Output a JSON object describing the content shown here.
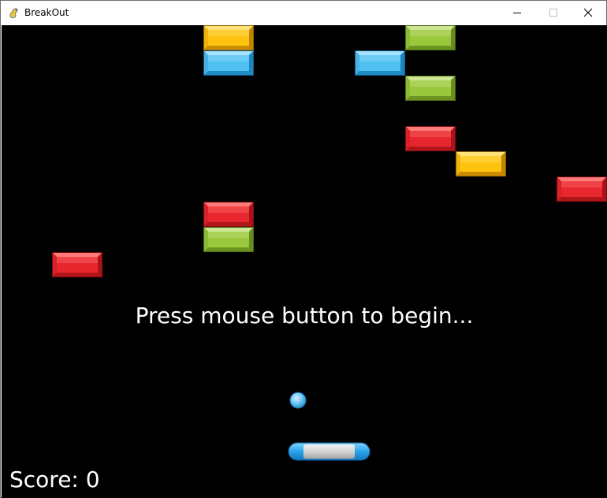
{
  "window": {
    "title": "BreakOut",
    "icon": "pygame-snake-icon",
    "controls": [
      "minimize-icon",
      "maximize-icon",
      "close-icon"
    ]
  },
  "game": {
    "message": "Press mouse button to begin...",
    "score_label": "Score: 0",
    "score": 0,
    "colors": {
      "background": "#000000",
      "text": "#ffffff",
      "yellow": "#ffc20e",
      "blue": "#4fc1f0",
      "green": "#9ac83c",
      "red": "#e8262d"
    },
    "bricks": [
      {
        "color": "yellow",
        "col": 4,
        "row": 0
      },
      {
        "color": "green",
        "col": 8,
        "row": 0
      },
      {
        "color": "blue",
        "col": 4,
        "row": 1
      },
      {
        "color": "blue",
        "col": 7,
        "row": 1
      },
      {
        "color": "green",
        "col": 8,
        "row": 2
      },
      {
        "color": "red",
        "col": 8,
        "row": 4
      },
      {
        "color": "yellow",
        "col": 9,
        "row": 5
      },
      {
        "color": "red",
        "col": 11,
        "row": 6
      },
      {
        "color": "red",
        "col": 4,
        "row": 7
      },
      {
        "color": "green",
        "col": 4,
        "row": 8
      },
      {
        "color": "red",
        "col": 1,
        "row": 9
      }
    ]
  }
}
